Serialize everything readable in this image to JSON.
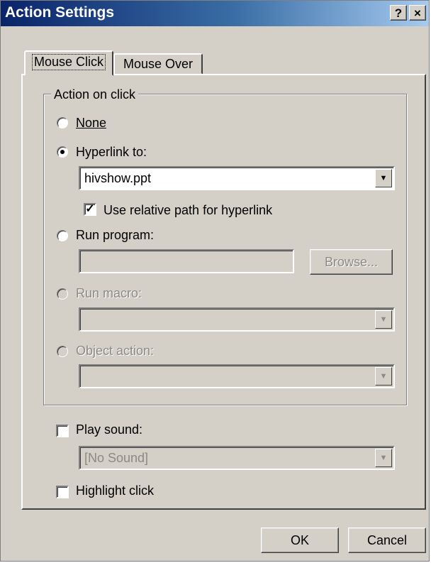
{
  "window": {
    "title": "Action Settings",
    "help_label": "?",
    "close_label": "×"
  },
  "tabs": [
    {
      "label": "Mouse Click",
      "active": true
    },
    {
      "label": "Mouse Over",
      "active": false
    }
  ],
  "action_group": {
    "title": "Action on click",
    "options": {
      "none": {
        "label": "None",
        "selected": false,
        "enabled": true
      },
      "hyperlink": {
        "label": "Hyperlink to:",
        "selected": true,
        "enabled": true
      },
      "run_program": {
        "label": "Run program:",
        "selected": false,
        "enabled": true
      },
      "run_macro": {
        "label": "Run macro:",
        "selected": false,
        "enabled": false
      },
      "object_action": {
        "label": "Object action:",
        "selected": false,
        "enabled": false
      }
    },
    "hyperlink_value": "hivshow.ppt",
    "use_relative_path": {
      "label": "Use relative path for hyperlink",
      "checked": true
    },
    "run_program_value": "",
    "browse_label": "Browse...",
    "run_macro_value": "",
    "object_action_value": ""
  },
  "play_sound": {
    "label": "Play sound:",
    "checked": false
  },
  "sound_value": "[No Sound]",
  "highlight_click": {
    "label": "Highlight click",
    "checked": false
  },
  "buttons": {
    "ok": "OK",
    "cancel": "Cancel"
  },
  "icons": {
    "checkmark": "check-icon",
    "dropdown": "chevron-down-icon"
  }
}
